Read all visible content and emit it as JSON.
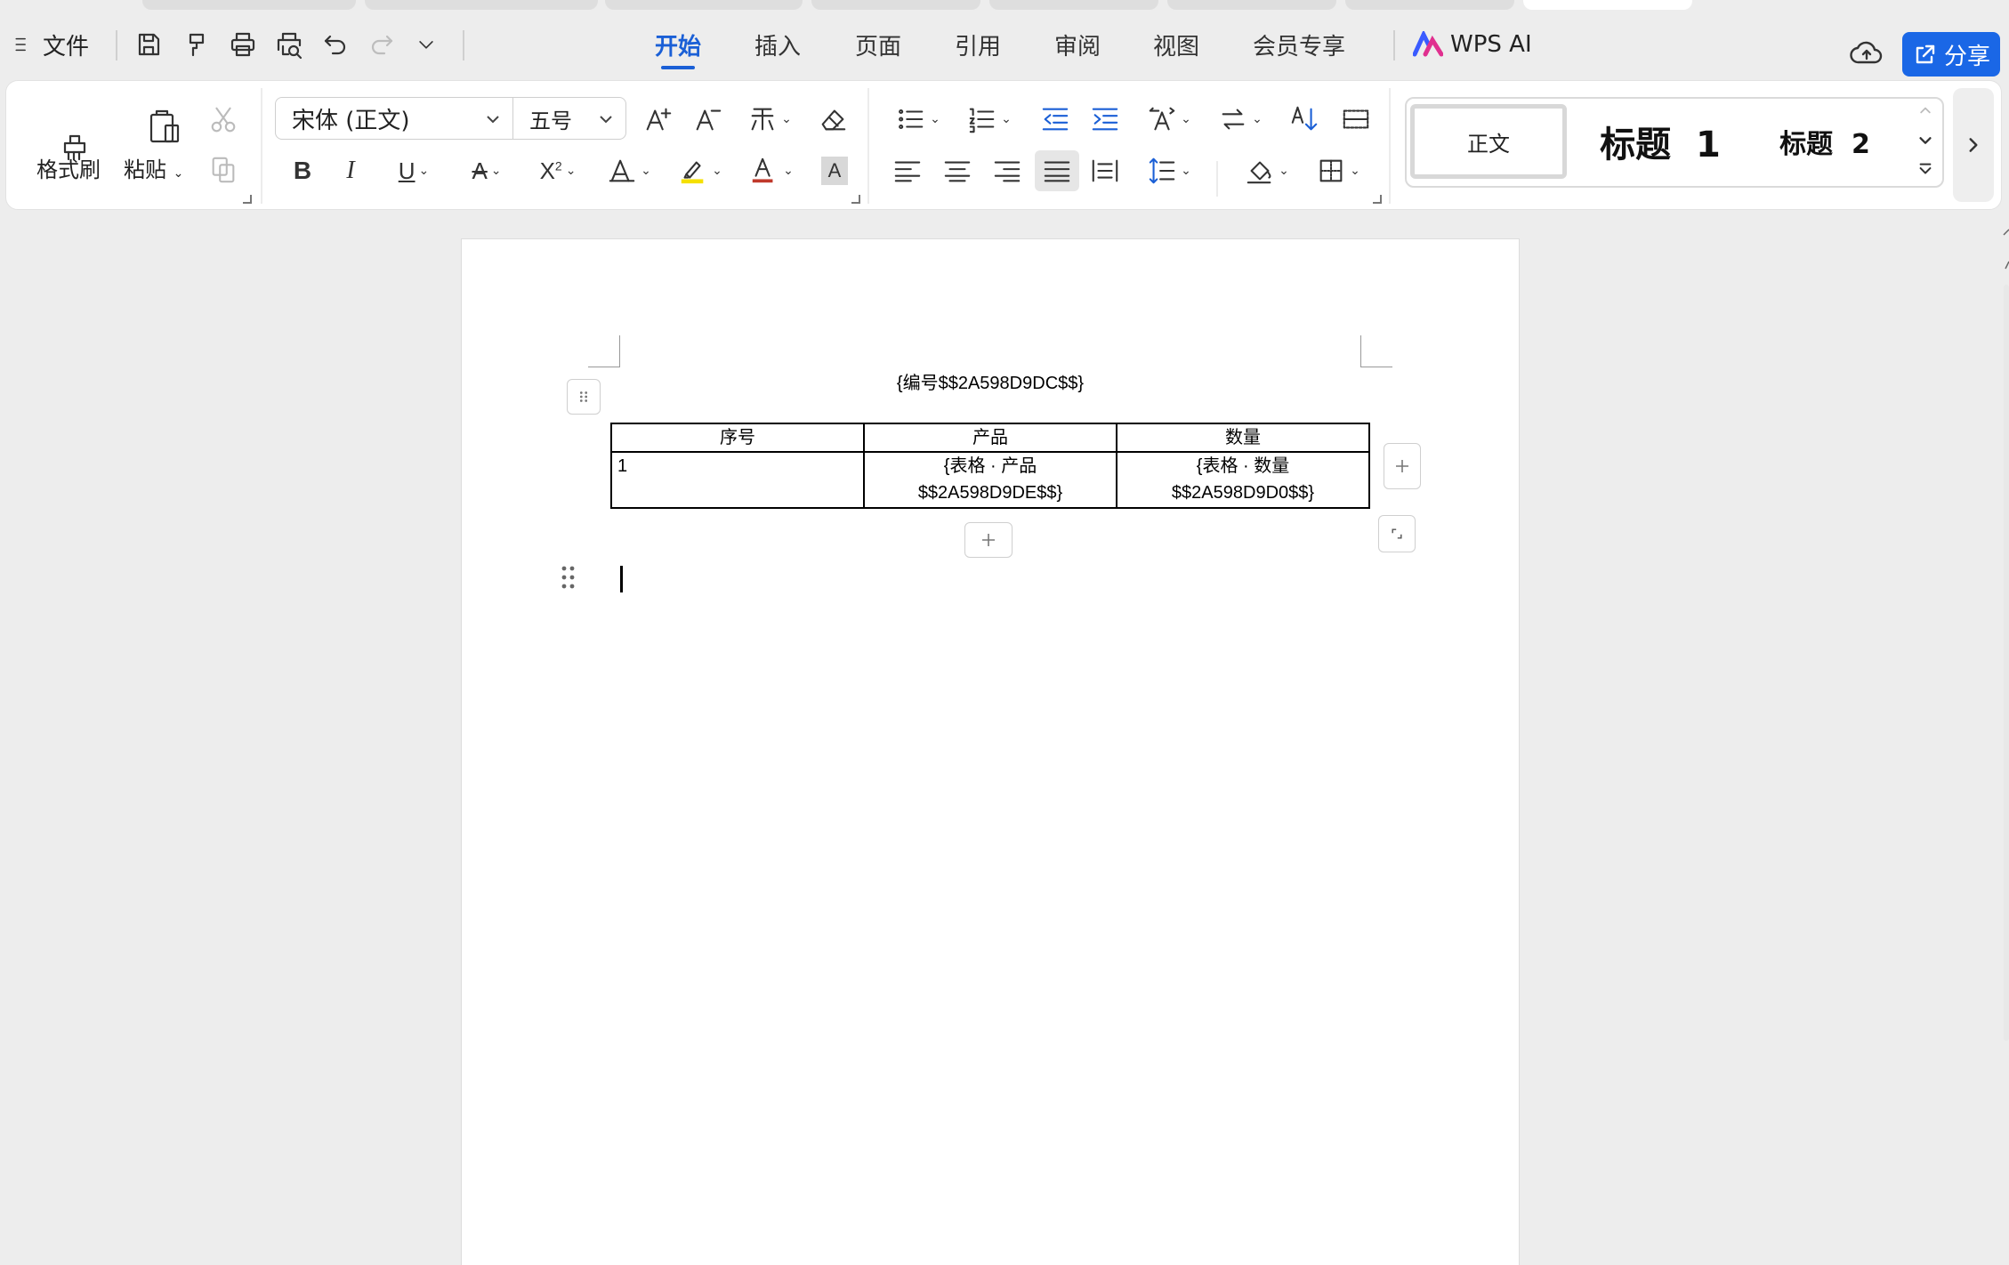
{
  "menubar": {
    "file_label": "文件",
    "tabs": [
      "开始",
      "插入",
      "页面",
      "引用",
      "审阅",
      "视图",
      "会员专享"
    ],
    "active_tab": "开始",
    "wps_ai_label": "WPS AI",
    "share_label": "分享",
    "accent_color": "#1a67e6"
  },
  "ribbon": {
    "format_painter_label": "格式刷",
    "paste_label": "粘贴",
    "font_name": "宋体 (正文)",
    "font_size": "五号",
    "styles": {
      "normal": "正文",
      "heading1": "标题  1",
      "heading2": "标题  2"
    }
  },
  "document": {
    "title_text": "{编号$$2A598D9DC$$}",
    "table": {
      "headers": [
        "序号",
        "产品",
        "数量"
      ],
      "rows": [
        [
          "1",
          "{表格 · 产品\n$$2A598D9DE$$}",
          "{表格 · 数量\n$$2A598D9D0$$}"
        ]
      ]
    }
  }
}
